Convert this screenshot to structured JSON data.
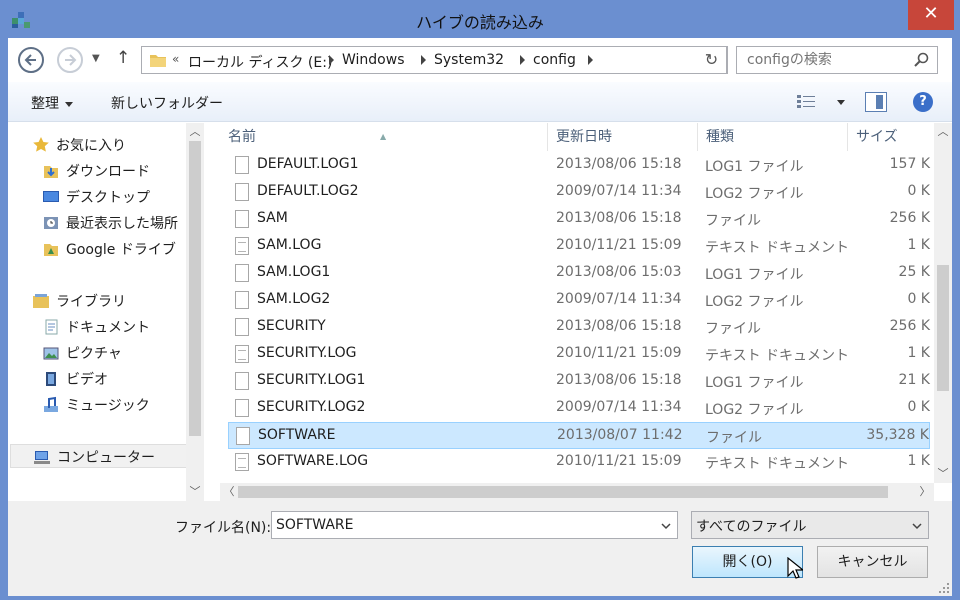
{
  "window": {
    "title": "ハイブの読み込み",
    "close_label": "✕"
  },
  "address": {
    "overflow": "«",
    "crumbs": [
      "ローカル ディスク (E:)",
      "Windows",
      "System32",
      "config"
    ]
  },
  "search": {
    "placeholder": "configの検索"
  },
  "toolbar": {
    "organize_label": "整理",
    "new_folder_label": "新しいフォルダー",
    "help_label": "?"
  },
  "nav": {
    "items": [
      {
        "label": "お気に入り",
        "icon": "star-icon"
      },
      {
        "label": "ダウンロード",
        "icon": "download-folder-icon"
      },
      {
        "label": "デスクトップ",
        "icon": "desktop-icon"
      },
      {
        "label": "最近表示した場所",
        "icon": "recent-places-icon"
      },
      {
        "label": "Google ドライブ",
        "icon": "google-drive-icon"
      },
      {
        "label": "ライブラリ",
        "icon": "library-icon"
      },
      {
        "label": "ドキュメント",
        "icon": "documents-icon"
      },
      {
        "label": "ピクチャ",
        "icon": "pictures-icon"
      },
      {
        "label": "ビデオ",
        "icon": "videos-icon"
      },
      {
        "label": "ミュージック",
        "icon": "music-icon"
      },
      {
        "label": "コンピューター",
        "icon": "computer-icon"
      }
    ]
  },
  "columns": {
    "name": "名前",
    "date": "更新日時",
    "type": "種類",
    "size": "サイズ"
  },
  "files": [
    {
      "name": "DEFAULT.LOG1",
      "date": "2013/08/06 15:18",
      "type": "LOG1 ファイル",
      "size": "157 K"
    },
    {
      "name": "DEFAULT.LOG2",
      "date": "2009/07/14 11:34",
      "type": "LOG2 ファイル",
      "size": "0 K"
    },
    {
      "name": "SAM",
      "date": "2013/08/06 15:18",
      "type": "ファイル",
      "size": "256 K"
    },
    {
      "name": "SAM.LOG",
      "date": "2010/11/21 15:09",
      "type": "テキスト ドキュメント",
      "size": "1 K"
    },
    {
      "name": "SAM.LOG1",
      "date": "2013/08/06 15:03",
      "type": "LOG1 ファイル",
      "size": "25 K"
    },
    {
      "name": "SAM.LOG2",
      "date": "2009/07/14 11:34",
      "type": "LOG2 ファイル",
      "size": "0 K"
    },
    {
      "name": "SECURITY",
      "date": "2013/08/06 15:18",
      "type": "ファイル",
      "size": "256 K"
    },
    {
      "name": "SECURITY.LOG",
      "date": "2010/11/21 15:09",
      "type": "テキスト ドキュメント",
      "size": "1 K"
    },
    {
      "name": "SECURITY.LOG1",
      "date": "2013/08/06 15:18",
      "type": "LOG1 ファイル",
      "size": "21 K"
    },
    {
      "name": "SECURITY.LOG2",
      "date": "2009/07/14 11:34",
      "type": "LOG2 ファイル",
      "size": "0 K"
    },
    {
      "name": "SOFTWARE",
      "date": "2013/08/07 11:42",
      "type": "ファイル",
      "size": "35,328 K",
      "selected": true
    },
    {
      "name": "SOFTWARE.LOG",
      "date": "2010/11/21 15:09",
      "type": "テキスト ドキュメント",
      "size": "1 K"
    }
  ],
  "bottom": {
    "filename_label": "ファイル名(N):",
    "filename_value": "SOFTWARE",
    "filetype_value": "すべてのファイル",
    "open_label": "開く(O)",
    "cancel_label": "キャンセル"
  },
  "colors": {
    "title_bar": "#6b8fd0",
    "close": "#c7463a",
    "selection": "#cce8ff",
    "selection_border": "#99d1ff"
  }
}
